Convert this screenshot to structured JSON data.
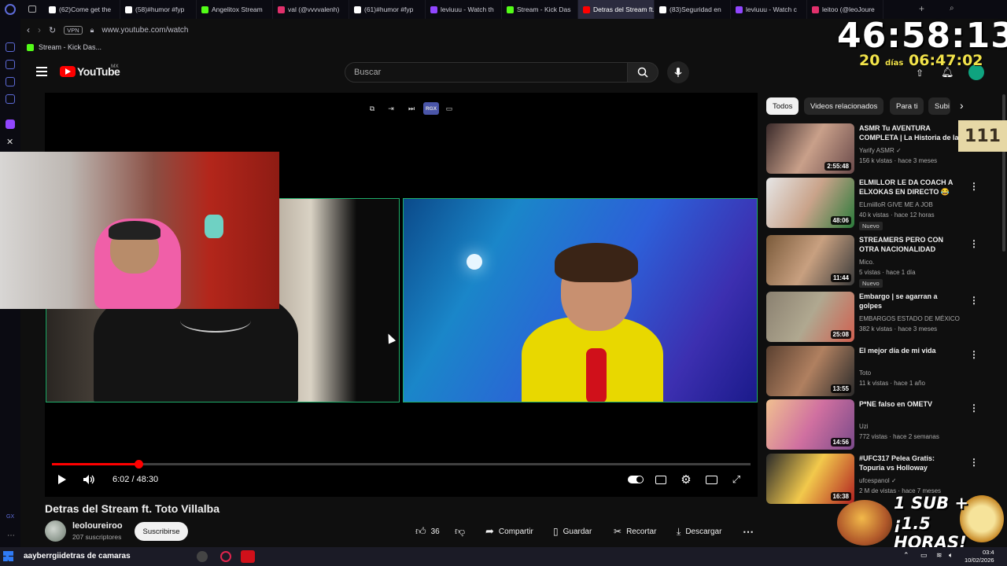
{
  "browser": {
    "tabs": [
      {
        "label": "(62)Come get the",
        "color": "#ffffff"
      },
      {
        "label": "(58)#humor #fyp",
        "color": "#ffffff"
      },
      {
        "label": "Angelitox Stream",
        "color": "#53fc18"
      },
      {
        "label": "val (@vvvvalenh)",
        "color": "#e1306c"
      },
      {
        "label": "(61)#humor #fyp",
        "color": "#ffffff"
      },
      {
        "label": "leviuuu - Watch th",
        "color": "#9146ff"
      },
      {
        "label": "Stream - Kick Das",
        "color": "#53fc18"
      },
      {
        "label": "Detras del Stream ft.",
        "color": "#ff0000",
        "active": true
      },
      {
        "label": "(83)Seguridad en",
        "color": "#ffffff"
      },
      {
        "label": "leviuuu - Watch c",
        "color": "#9146ff"
      },
      {
        "label": "leitoo (@leoJoure",
        "color": "#e1306c"
      }
    ],
    "url": "www.youtube.com/watch",
    "vpn_label": "VPN",
    "bookmark": "Stream - Kick Das..."
  },
  "youtube": {
    "logo_text": "YouTube",
    "region": "MX",
    "search_placeholder": "Buscar"
  },
  "player": {
    "current_time": "6:02",
    "duration": "48:30",
    "time_display": "6:02 / 48:30",
    "progress_fraction": 0.1244,
    "top_controls": [
      "miniplayer-icon",
      "exit-icon",
      "skip-icon",
      "rgx-badge",
      "theater-icon"
    ],
    "rgx_label": "RGX"
  },
  "video": {
    "title": "Detras del Stream ft. Toto Villalba",
    "channel": "leoloureiroo",
    "subscribers": "207 suscriptores",
    "subscribe_label": "Suscribirse",
    "likes": "36",
    "share_label": "Compartir",
    "save_label": "Guardar",
    "clip_label": "Recortar",
    "download_label": "Descargar"
  },
  "sidebar": {
    "chips": [
      "Todos",
      "Videos relacionados",
      "Para ti",
      "Subi"
    ],
    "items": [
      {
        "title": "ASMR Tu AVENTURA COMPLETA | La Historia de la",
        "channel": "Yarify ASMR ✓",
        "meta": "156 k vistas · hace 3 meses",
        "duration": "2:55:48",
        "nuevo": ""
      },
      {
        "title": "ELMILLOR LE DA COACH A ELXOKAS EN DIRECTO 😂",
        "channel": "ELmiilloR GIVE ME A JOB",
        "meta": "40 k vistas · hace 12 horas",
        "duration": "48:06",
        "nuevo": "Nuevo"
      },
      {
        "title": "STREAMERS PERO CON OTRA NACIONALIDAD",
        "channel": "Mico.",
        "meta": "5 vistas · hace 1 día",
        "duration": "11:44",
        "nuevo": "Nuevo"
      },
      {
        "title": "Embargo | se agarran a golpes",
        "channel": "EMBARGOS ESTADO DE MÉXICO",
        "meta": "382 k vistas · hace 3 meses",
        "duration": "25:08",
        "nuevo": ""
      },
      {
        "title": "El mejor día de mi vida",
        "channel": "Toto",
        "meta": "11 k vistas · hace 1 año",
        "duration": "13:55",
        "nuevo": ""
      },
      {
        "title": "P*NE falso en OMETV",
        "channel": "Uzi",
        "meta": "772 vistas · hace 2 semanas",
        "duration": "14:56",
        "nuevo": ""
      },
      {
        "title": "#UFC317 Pelea Gratis: Topuria vs Holloway",
        "channel": "ufcespanol ✓",
        "meta": "2 M de vistas · hace 7 meses",
        "duration": "16:38",
        "nuevo": ""
      }
    ]
  },
  "overlay": {
    "timer": "46:58:13",
    "days_count": "20",
    "days_label": "días",
    "days_time": "06:47:02",
    "counter": "111",
    "promo_line1": "1 SUB +",
    "promo_line2": "¡1.5 HORAS!"
  },
  "taskbar": {
    "marquee": "aayberrgiidetras de camaras",
    "clock_time": "03:4",
    "clock_date": "10/02/2026"
  }
}
